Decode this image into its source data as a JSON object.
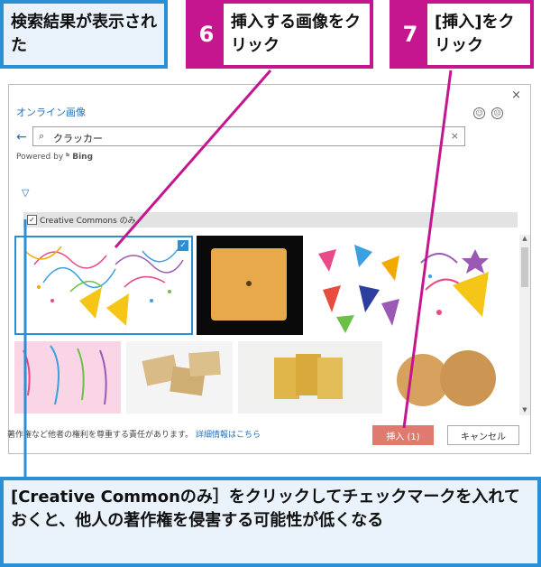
{
  "callouts": {
    "top_left": "検索結果が表示された",
    "step6": {
      "number": "6",
      "text": "挿入する画像をクリック"
    },
    "step7": {
      "number": "7",
      "text": "[挿入]をクリック"
    },
    "bottom": "[Creative Commonのみ］をクリックしてチェックマークを入れておくと、他人の著作権を侵害する可能性が低くなる"
  },
  "dialog": {
    "title": "オンライン画像",
    "close": "×",
    "search": {
      "value": "クラッカー",
      "clear": "×"
    },
    "powered_by": "Powered by",
    "bing": "Bing",
    "filter_icon": "funnel-icon",
    "cc_filter": {
      "label": "Creative Commons のみ",
      "checked": true
    },
    "results": [
      {
        "name": "party-popper-illustration",
        "selected": true
      },
      {
        "name": "cheese-cracker-photo",
        "selected": false
      },
      {
        "name": "party-hats-illustration",
        "selected": false
      },
      {
        "name": "party-horn-illustration",
        "selected": false
      },
      {
        "name": "streamers-illustration",
        "selected": false
      },
      {
        "name": "square-crackers-photo",
        "selected": false
      },
      {
        "name": "golden-crackers-photo",
        "selected": false
      },
      {
        "name": "round-crackers-photo",
        "selected": false
      }
    ],
    "footer_notice": "著作権など他者の権利を尊重する責任があります。",
    "footer_link": "詳細情報はこちら",
    "insert_label": "挿入 (1)",
    "cancel_label": "キャンセル"
  },
  "colors": {
    "blue": "#2b8fd6",
    "magenta": "#c5168f",
    "insert": "#e07a6f"
  }
}
